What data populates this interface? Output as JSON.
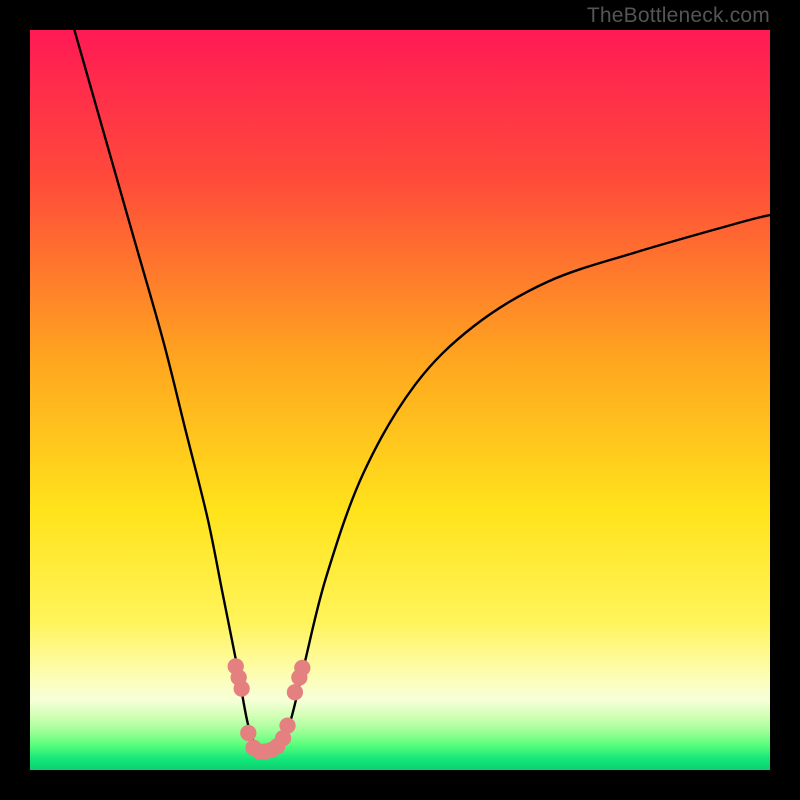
{
  "watermark": "TheBottleneck.com",
  "chart_data": {
    "type": "line",
    "title": "",
    "xlabel": "",
    "ylabel": "",
    "xlim": [
      0,
      100
    ],
    "ylim": [
      0,
      100
    ],
    "background_gradient_stops": [
      {
        "offset": 0.0,
        "color": "#ff1a55"
      },
      {
        "offset": 0.2,
        "color": "#ff4a3a"
      },
      {
        "offset": 0.45,
        "color": "#ffa71f"
      },
      {
        "offset": 0.65,
        "color": "#ffe31b"
      },
      {
        "offset": 0.8,
        "color": "#fff45a"
      },
      {
        "offset": 0.87,
        "color": "#fdfdb0"
      },
      {
        "offset": 0.905,
        "color": "#f7ffd8"
      },
      {
        "offset": 0.925,
        "color": "#d6ffb8"
      },
      {
        "offset": 0.945,
        "color": "#a6ff9a"
      },
      {
        "offset": 0.965,
        "color": "#5cff7d"
      },
      {
        "offset": 0.985,
        "color": "#14e77a"
      },
      {
        "offset": 1.0,
        "color": "#0bd06f"
      }
    ],
    "series": [
      {
        "name": "bottleneck-curve",
        "color": "#000000",
        "x": [
          6,
          10,
          14,
          18,
          21,
          24,
          26,
          28,
          29.5,
          31,
          33,
          35,
          37,
          40,
          45,
          52,
          60,
          70,
          82,
          96,
          100
        ],
        "y": [
          100,
          86,
          72,
          58,
          46,
          34,
          24,
          14,
          6,
          2.5,
          2.5,
          6,
          14,
          26,
          40,
          52,
          60,
          66,
          70,
          74,
          75
        ]
      }
    ],
    "markers": {
      "name": "dotted-band",
      "color": "#e58080",
      "radius_frac": 0.011,
      "points": [
        {
          "x": 27.8,
          "y": 14.0
        },
        {
          "x": 28.2,
          "y": 12.5
        },
        {
          "x": 28.6,
          "y": 11.0
        },
        {
          "x": 29.5,
          "y": 5.0
        },
        {
          "x": 30.2,
          "y": 3.0
        },
        {
          "x": 31.0,
          "y": 2.5
        },
        {
          "x": 31.8,
          "y": 2.5
        },
        {
          "x": 32.6,
          "y": 2.7
        },
        {
          "x": 33.4,
          "y": 3.2
        },
        {
          "x": 34.2,
          "y": 4.3
        },
        {
          "x": 34.8,
          "y": 6.0
        },
        {
          "x": 35.8,
          "y": 10.5
        },
        {
          "x": 36.4,
          "y": 12.5
        },
        {
          "x": 36.8,
          "y": 13.8
        }
      ]
    }
  }
}
